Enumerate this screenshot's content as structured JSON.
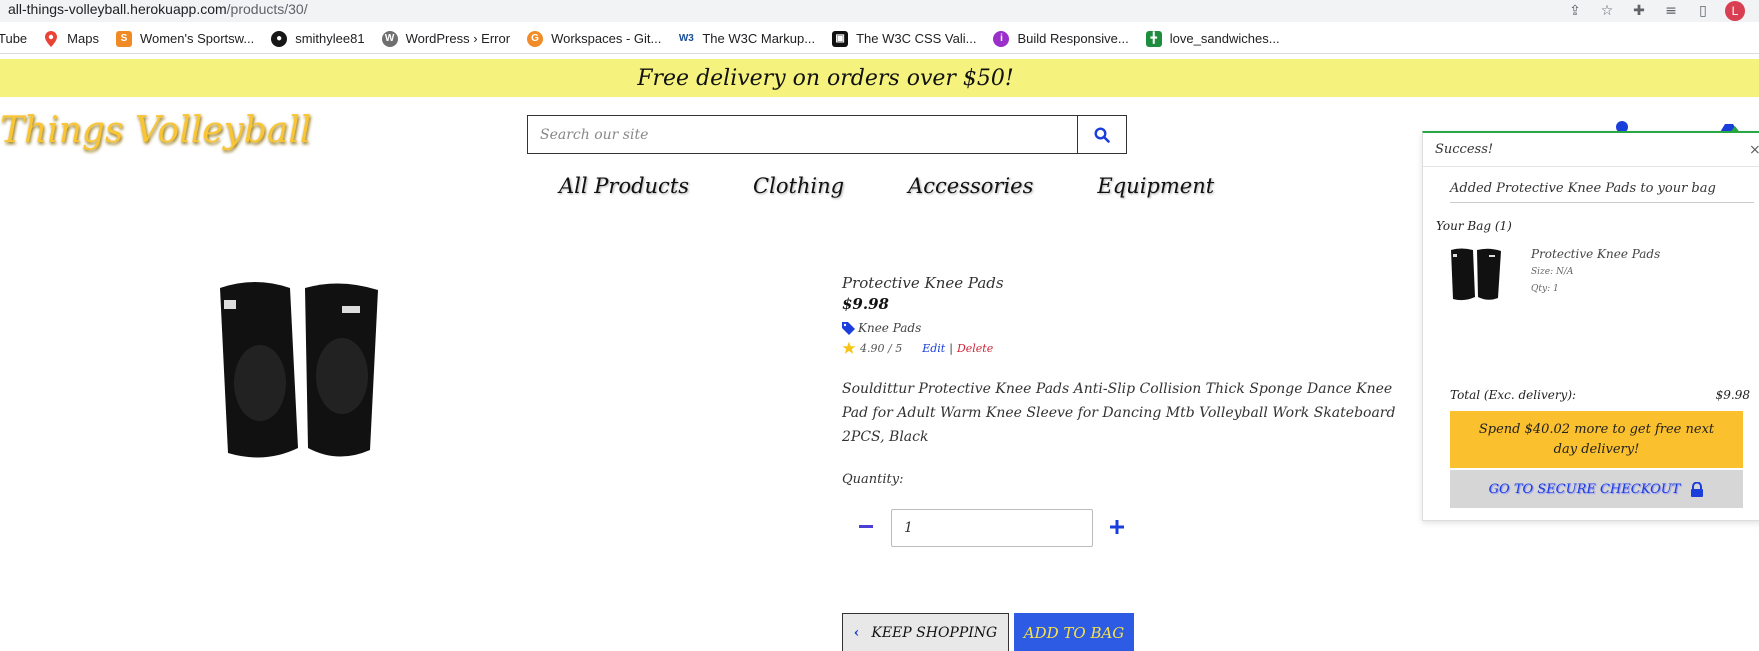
{
  "browser": {
    "url_host": "all-things-volleyball.herokuapp.com",
    "url_path": "/products/30/",
    "profile_initial": "L",
    "bookmarks": [
      {
        "label": "Tube",
        "icon": "youtube-icon"
      },
      {
        "label": "Maps",
        "icon": "maps-icon",
        "color": "#34a853"
      },
      {
        "label": "Women's Sportsw...",
        "icon": "sportswear-icon",
        "color": "#f08a24"
      },
      {
        "label": "smithylee81",
        "icon": "github-icon",
        "color": "#181717"
      },
      {
        "label": "WordPress › Error",
        "icon": "wordpress-icon",
        "color": "#6f6f6f"
      },
      {
        "label": "Workspaces - Git...",
        "icon": "gitpod-icon",
        "color": "#f28c28"
      },
      {
        "label": "The W3C Markup...",
        "icon": "w3c-icon",
        "color": "#1a4e9a"
      },
      {
        "label": "The W3C CSS Vali...",
        "icon": "w3c-css-icon",
        "color": "#111111"
      },
      {
        "label": "Build Responsive...",
        "icon": "course-icon",
        "color": "#9b2fc9"
      },
      {
        "label": "love_sandwiches...",
        "icon": "sheets-icon",
        "color": "#1e8e3e"
      }
    ]
  },
  "promo": {
    "text": "Free delivery on orders over $50!"
  },
  "logo": {
    "text": "Things Volleyball"
  },
  "search": {
    "placeholder": "Search our site"
  },
  "nav": [
    {
      "label": "All Products"
    },
    {
      "label": "Clothing"
    },
    {
      "label": "Accessories"
    },
    {
      "label": "Equipment"
    }
  ],
  "product": {
    "name": "Protective Knee Pads",
    "price": "$9.98",
    "category": "Knee Pads",
    "rating": "4.90 / 5",
    "edit_label": "Edit",
    "separator": "|",
    "delete_label": "Delete",
    "description": "Souldittur Protective Knee Pads Anti-Slip Collision Thick Sponge Dance Knee Pad for Adult Warm Knee Sleeve for Dancing Mtb Volleyball Work Skateboard 2PCS, Black",
    "quantity_label": "Quantity:",
    "quantity_value": "1",
    "keep_shopping_label": "KEEP SHOPPING",
    "add_to_bag_label": "ADD TO BAG"
  },
  "toast": {
    "title": "Success!",
    "close": "×",
    "message": "Added Protective Knee Pads to your bag",
    "bag_title": "Your Bag (1)",
    "item": {
      "name": "Protective Knee Pads",
      "size": "Size: N/A",
      "qty": "Qty: 1"
    },
    "total_label": "Total (Exc. delivery):",
    "total_value": "$9.98",
    "free_delivery_msg": "Spend $40.02 more to get free next day delivery!",
    "checkout_label": "GO TO SECURE CHECKOUT"
  },
  "colors": {
    "promo_bg": "#f5f37e",
    "logo": "#f9c535",
    "accent_blue": "#1a3edb",
    "add_btn_bg": "#2d5be3",
    "toast_success": "#28a745",
    "delivery_bg": "#fbc02d"
  }
}
